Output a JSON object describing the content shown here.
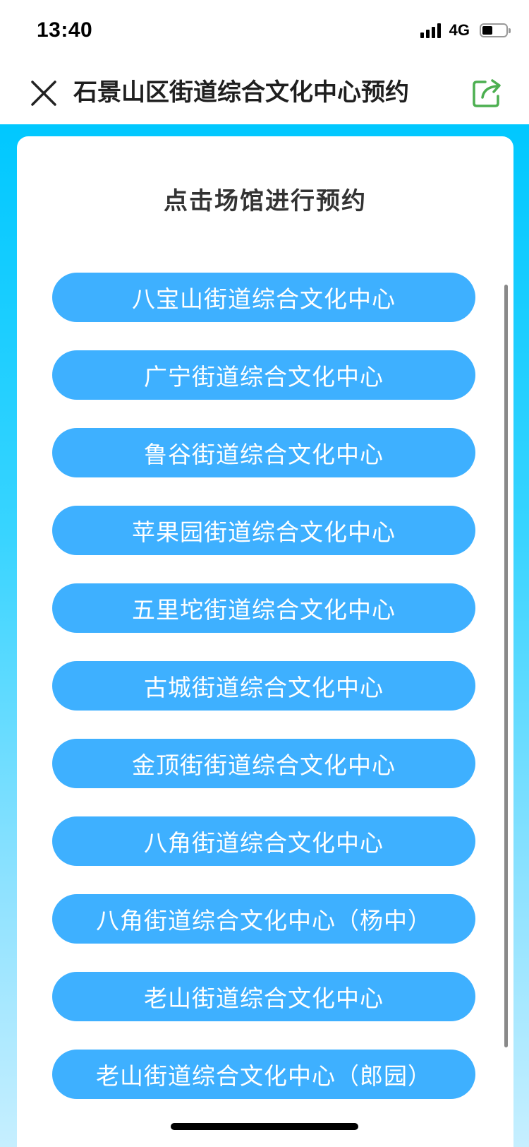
{
  "status_bar": {
    "time": "13:40",
    "network": "4G",
    "battery_level": 0.45
  },
  "nav": {
    "title": "石景山区街道综合文化中心预约",
    "share_icon_color": "#4caf50"
  },
  "card": {
    "title": "点击场馆进行预约"
  },
  "venues": [
    "八宝山街道综合文化中心",
    "广宁街道综合文化中心",
    "鲁谷街道综合文化中心",
    "苹果园街道综合文化中心",
    "五里坨街道综合文化中心",
    "古城街道综合文化中心",
    "金顶街街道综合文化中心",
    "八角街道综合文化中心",
    "八角街道综合文化中心（杨中）",
    "老山街道综合文化中心",
    "老山街道综合文化中心（郎园）"
  ],
  "colors": {
    "button_blue": "#3eb0ff",
    "background_cyan": "#00c8ff"
  }
}
